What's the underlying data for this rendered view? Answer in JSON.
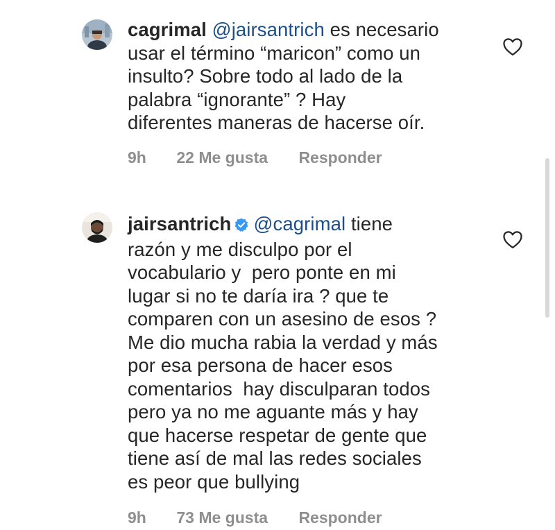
{
  "comments": [
    {
      "username": "cagrimal",
      "verified": false,
      "mention": "@jairsantrich",
      "lines": [
        "es necesario",
        "usar el término “maricon” como un",
        "insulto? Sobre todo al lado de la",
        "palabra “ignorante” ? Hay",
        "diferentes maneras de hacerse oír."
      ],
      "time": "9h",
      "likes": "22 Me gusta",
      "reply": "Responder"
    },
    {
      "username": "jairsantrich",
      "verified": true,
      "mention": "@cagrimal",
      "lines": [
        " tiene",
        "razón y me disculpo por el",
        "vocabulario y  pero ponte en mi",
        "lugar si no te daría ira ? que te",
        "comparen con un asesino de esos ?",
        "Me dio mucha rabia la verdad y más",
        "por esa persona de hacer esos",
        "comentarios  hay disculparan todos",
        "pero ya no me aguante más y hay",
        "que hacerse respetar de gente que",
        "tiene así de mal las redes sociales",
        "es peor que bullying"
      ],
      "time": "9h",
      "likes": "73 Me gusta",
      "reply": "Responder"
    }
  ],
  "colors": {
    "text": "#262626",
    "mention": "#1a4f8a",
    "meta": "#8e8e8e",
    "verified": "#3897f0"
  },
  "icons": {
    "like": "heart-outline-icon",
    "verified": "verified-badge-icon"
  }
}
